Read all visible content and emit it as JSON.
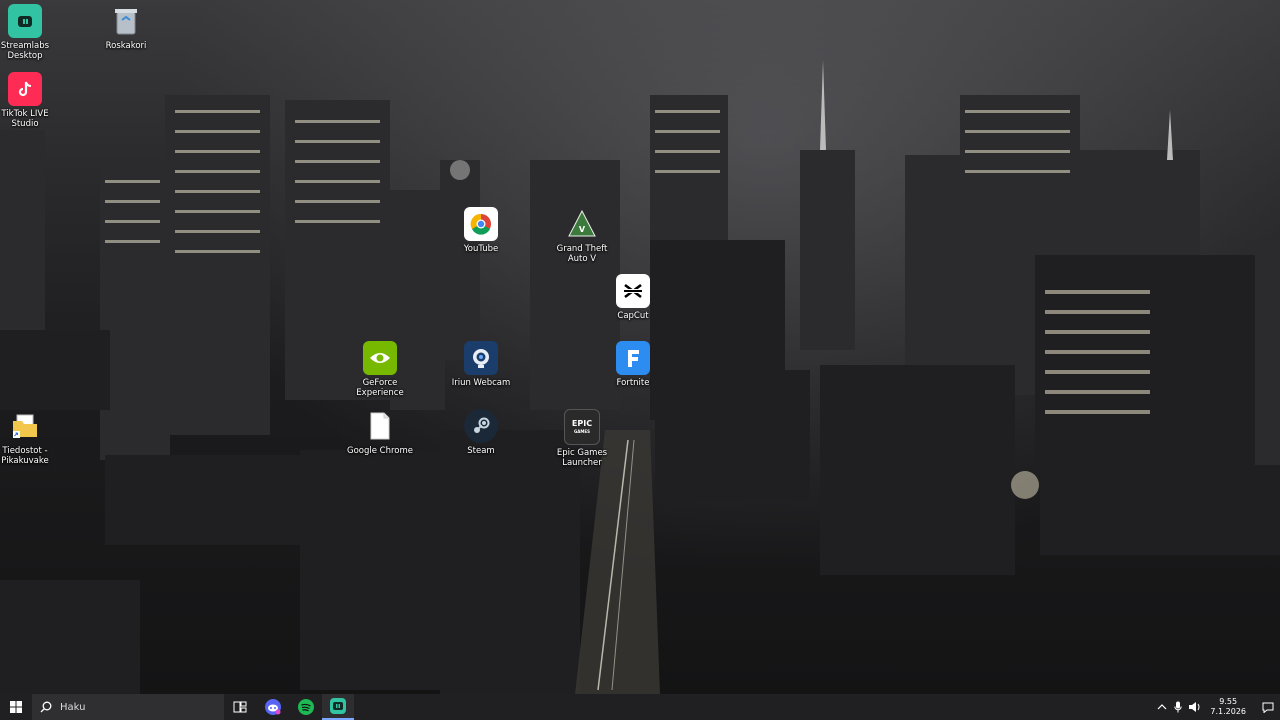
{
  "desktop": {
    "icons": [
      {
        "label": "Streamlabs Desktop",
        "icon": "streamlabs-icon",
        "color": "#31c3a2"
      },
      {
        "label": "Roskakori",
        "icon": "recycle-bin-icon",
        "color": "#9aa4ad"
      },
      {
        "label": "TikTok LIVE Studio",
        "icon": "tiktok-icon",
        "color": "#fe2c55"
      },
      {
        "label": "YouTube",
        "icon": "chrome-icon",
        "color": "#4285f4"
      },
      {
        "label": "Grand Theft Auto V",
        "icon": "gta-icon",
        "color": "#3c7a3c"
      },
      {
        "label": "CapCut",
        "icon": "capcut-icon",
        "color": "#ffffff"
      },
      {
        "label": "GeForce Experience",
        "icon": "nvidia-icon",
        "color": "#76b900"
      },
      {
        "label": "Iriun Webcam",
        "icon": "webcam-icon",
        "color": "#1b3d6b"
      },
      {
        "label": "Fortnite",
        "icon": "fortnite-icon",
        "color": "#2d8cf0"
      },
      {
        "label": "Tiedostot - Pikakuvake",
        "icon": "folder-icon",
        "color": "#f3c64c"
      },
      {
        "label": "Google Chrome",
        "icon": "file-icon",
        "color": "#ffffff"
      },
      {
        "label": "Steam",
        "icon": "steam-icon",
        "color": "#1b2838"
      },
      {
        "label": "Epic Games Launcher",
        "icon": "epic-games-icon",
        "color": "#2a2a2a"
      }
    ]
  },
  "taskbar": {
    "search_placeholder": "Haku",
    "pinned": [
      {
        "name": "discord-icon",
        "color": "#5865f2"
      },
      {
        "name": "spotify-icon",
        "color": "#1db954"
      },
      {
        "name": "streamlabs-icon",
        "color": "#31c3a2"
      }
    ],
    "clock_time": "9.55",
    "clock_date": "7.1.2026"
  }
}
